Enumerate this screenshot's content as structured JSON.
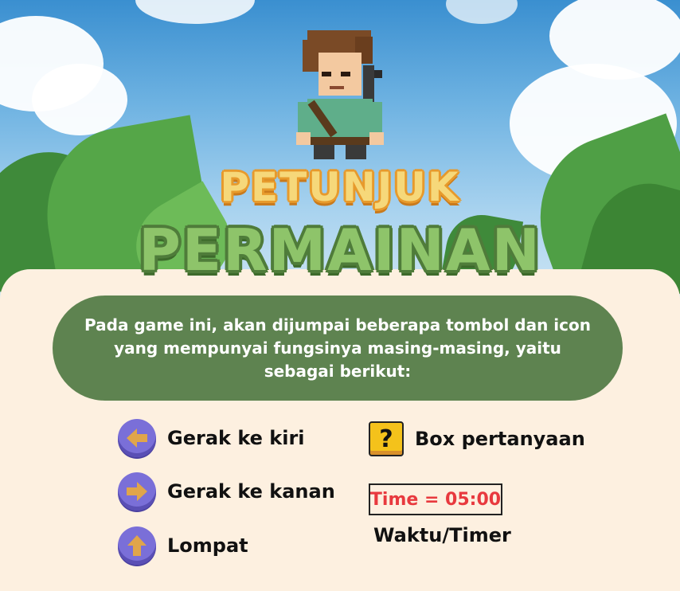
{
  "title": {
    "line1": "PETUNJUK",
    "line2": "PERMAINAN"
  },
  "intro": {
    "text": "Pada game ini, akan dijumpai beberapa tombol dan icon yang mempunyai fungsinya masing-masing, yaitu sebagai berikut:"
  },
  "controls": [
    {
      "icon": "arrow-left-icon",
      "label": "Gerak ke kiri"
    },
    {
      "icon": "arrow-right-icon",
      "label": "Gerak ke kanan"
    },
    {
      "icon": "arrow-up-icon",
      "label": "Lompat"
    }
  ],
  "question_box": {
    "icon": "question-box-icon",
    "symbol": "?",
    "label": "Box pertanyaan"
  },
  "timer": {
    "display": "Time = 05:00",
    "label": "Waktu/Timer"
  },
  "colors": {
    "intro_bg": "#5e8350",
    "panel_bg": "#fdf0e0",
    "button_purple": "#7a6fd8",
    "arrow_fill": "#e0a54a",
    "timer_red": "#e8393e",
    "title1_fill": "#f6d87a",
    "title2_fill": "#8ec46a"
  }
}
